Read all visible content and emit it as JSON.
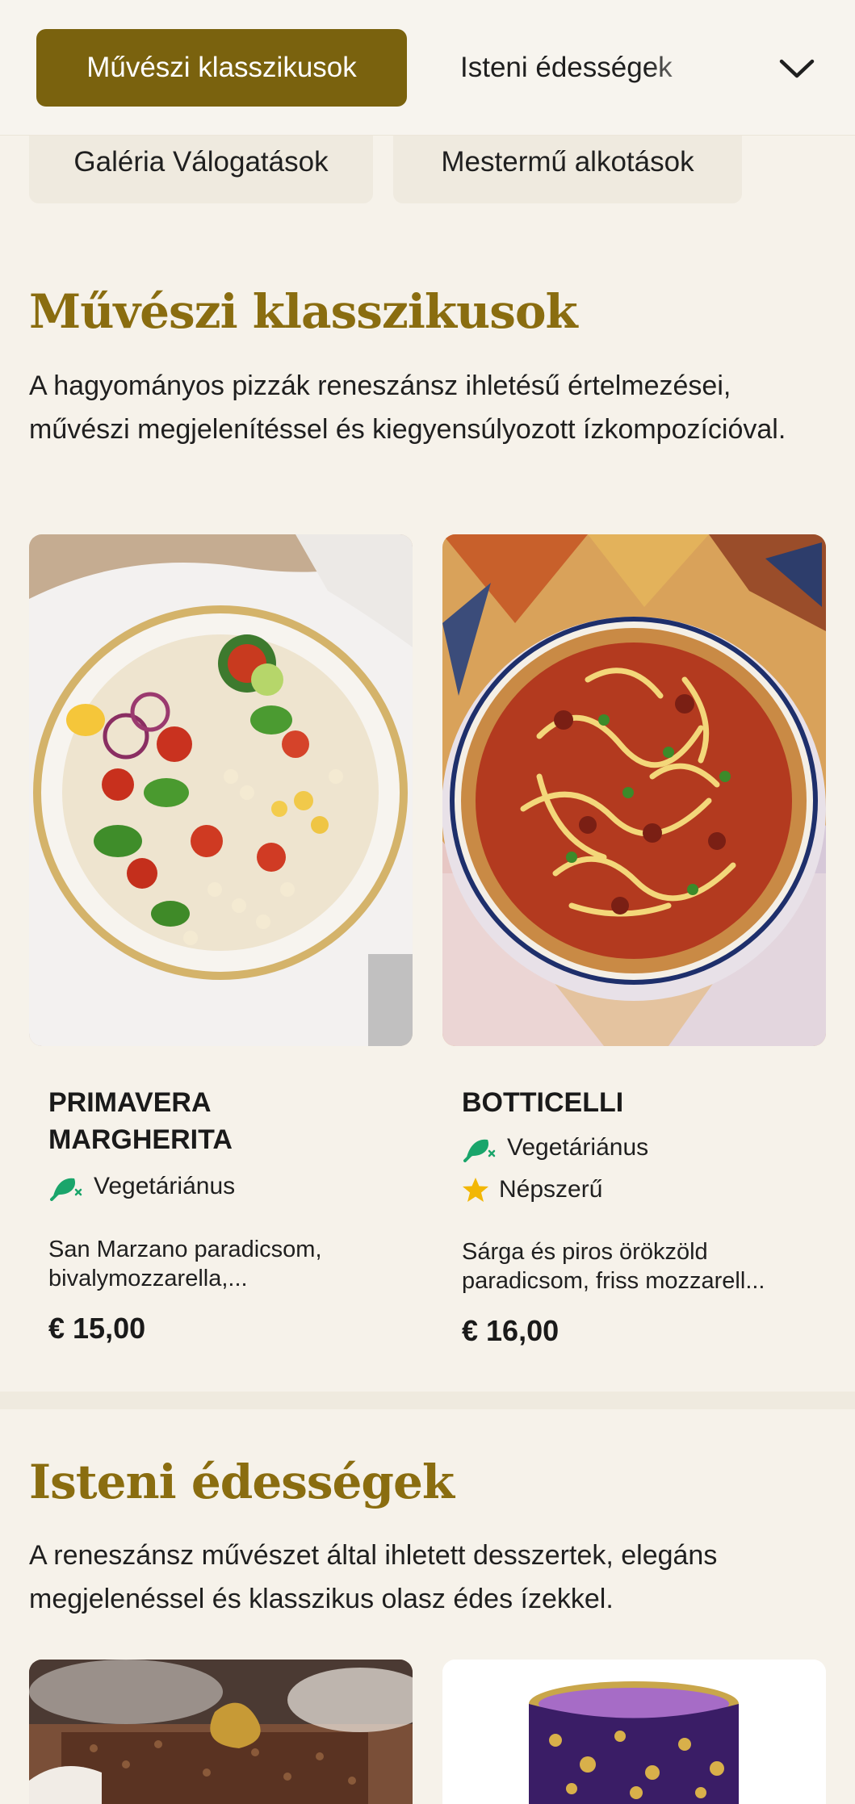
{
  "tabs": {
    "active": "Művészi klasszikusok",
    "next": "Isteni édességek"
  },
  "pills": [
    "Galéria Válogatások",
    "Mestermű alkotások"
  ],
  "sections": [
    {
      "title": "Művészi klasszikusok",
      "description": "A hagyományos pizzák reneszánsz ihletésű értelmezései, művészi megjelenítéssel és kiegyensúlyozott ízkompozícióval.",
      "items": [
        {
          "name": "PRIMAVERA MARGHERITA",
          "tags": [
            {
              "icon": "vegetarian-icon",
              "label": "Vegetáriánus"
            }
          ],
          "description": "San Marzano paradicsom, bivalymozzarella,...",
          "price": "€ 15,00"
        },
        {
          "name": "BOTTICELLI",
          "tags": [
            {
              "icon": "vegetarian-icon",
              "label": "Vegetáriánus"
            },
            {
              "icon": "star-icon",
              "label": "Népszerű"
            }
          ],
          "description": "Sárga és piros örökzöld paradicsom, friss mozzarell...",
          "price": "€ 16,00"
        }
      ]
    },
    {
      "title": "Isteni édességek",
      "description": "A reneszánsz művészet által ihletett desszertek, elegáns megjelenéssel és klasszikus olasz édes ízekkel."
    }
  ],
  "colors": {
    "accent": "#7a620e",
    "heading": "#8a6d10",
    "background": "#f6f2ea",
    "vegetarian": "#1aa56b",
    "star": "#f2b705"
  },
  "icons": {
    "dropdown": "chevron-down-icon"
  }
}
